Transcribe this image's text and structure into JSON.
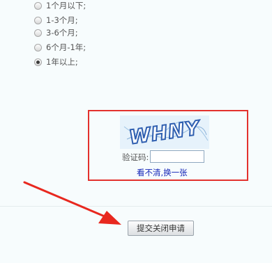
{
  "renewal_period": {
    "options": [
      {
        "label": "1个月以下;",
        "checked": false
      },
      {
        "label": "1-3个月;",
        "checked": false
      },
      {
        "label": "3-6个月;",
        "checked": false
      },
      {
        "label": "6个月-1年;",
        "checked": false
      },
      {
        "label": "1年以上;",
        "checked": true
      }
    ]
  },
  "captcha": {
    "image_text": "WHNY",
    "label": "验证码:",
    "input_value": "",
    "refresh_link": "看不清,换一张"
  },
  "form": {
    "submit_label": "提交关闭申请"
  },
  "colors": {
    "highlight_border": "#e3312d",
    "arrow": "#e8281f",
    "link": "#1526b8",
    "captcha_text": "#2f5fb0"
  }
}
